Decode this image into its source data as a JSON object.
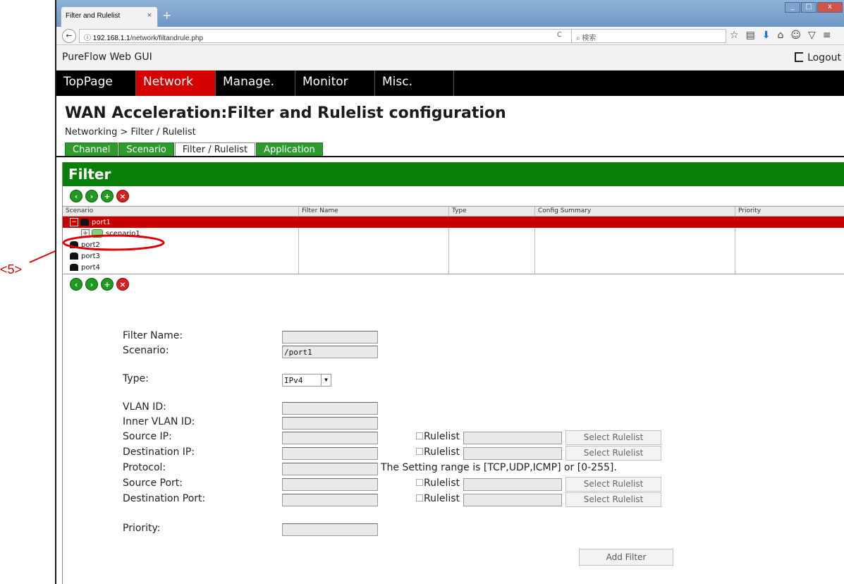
{
  "annotation": {
    "label": "<5>"
  },
  "browser": {
    "tab_title": "Filter and Rulelist",
    "tab_close": "×",
    "new_tab": "+",
    "url_host": "192.168.1.1",
    "url_path": "/network/filtandrule.php",
    "search_placeholder": "検索",
    "reload": "C"
  },
  "app": {
    "title": "PureFlow Web GUI",
    "logout_label": "Logout"
  },
  "menu": {
    "items": [
      {
        "label": "TopPage"
      },
      {
        "label": "Network"
      },
      {
        "label": "Manage."
      },
      {
        "label": "Monitor"
      },
      {
        "label": "Misc."
      }
    ],
    "active": "Network"
  },
  "page": {
    "title": "WAN Acceleration:Filter and Rulelist configuration",
    "breadcrumb": "Networking > Filter / Rulelist"
  },
  "subtabs": [
    {
      "label": "Channel"
    },
    {
      "label": "Scenario"
    },
    {
      "label": "Filter / Rulelist"
    },
    {
      "label": "Application"
    }
  ],
  "filter_panel": {
    "heading": "Filter",
    "columns": [
      "Scenario",
      "Filter Name",
      "Type",
      "Config Summary",
      "Priority"
    ],
    "tree": [
      {
        "label": "port1",
        "selected": true,
        "expanded": true,
        "toggle": "−"
      },
      {
        "label": "scenario1",
        "toggle": "+"
      },
      {
        "label": "port2"
      },
      {
        "label": "port3"
      },
      {
        "label": "port4"
      }
    ]
  },
  "form": {
    "filter_name": {
      "label": "Filter Name:",
      "value": ""
    },
    "scenario": {
      "label": "Scenario:",
      "value": "/port1"
    },
    "type": {
      "label": "Type:",
      "value": "IPv4"
    },
    "vlan_id": {
      "label": "VLAN ID:",
      "value": ""
    },
    "inner_vlan_id": {
      "label": "Inner VLAN ID:",
      "value": ""
    },
    "source_ip": {
      "label": "Source IP:",
      "value": ""
    },
    "destination_ip": {
      "label": "Destination IP:",
      "value": ""
    },
    "protocol": {
      "label": "Protocol:",
      "value": "",
      "note": "The Setting range is [TCP,UDP,ICMP] or [0-255]."
    },
    "source_port": {
      "label": "Source Port:",
      "value": ""
    },
    "destination_port": {
      "label": "Destination Port:",
      "value": ""
    },
    "priority": {
      "label": "Priority:",
      "value": ""
    },
    "rulelist_label": "Rulelist",
    "select_rulelist_label": "Select Rulelist",
    "add_filter_label": "Add Filter"
  },
  "colors": {
    "accent_red": "#d60000",
    "green": "#0a7f0a",
    "menubar": "#000000"
  }
}
